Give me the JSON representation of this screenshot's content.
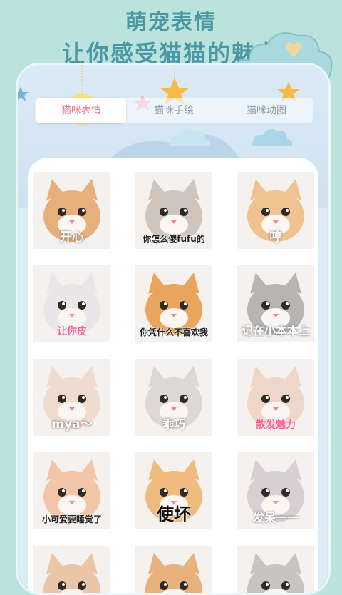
{
  "header": {
    "title_line1": "萌宠表情",
    "title_line2": "让你感受猫猫的魅力"
  },
  "tabs": [
    {
      "label": "猫咪表情",
      "active": true
    },
    {
      "label": "猫咪手绘",
      "active": false
    },
    {
      "label": "猫咪动图",
      "active": false
    }
  ],
  "stickers": [
    {
      "caption": "开心",
      "color": "#e7b07a"
    },
    {
      "caption": "你怎么傻fufu的",
      "color": "#cfc5bd"
    },
    {
      "caption": "哼",
      "color": "#f0c290"
    },
    {
      "caption": "让你皮",
      "color": "#e8e6e8"
    },
    {
      "caption": "你凭什么不喜欢我",
      "color": "#e9a55c"
    },
    {
      "caption": "记在小本本上",
      "color": "#b7b4b4"
    },
    {
      "caption": "mya～",
      "color": "#f0dccf"
    },
    {
      "caption": "乖巧",
      "color": "#ddd8d1"
    },
    {
      "caption": "散发魅力",
      "color": "#eed6c8"
    },
    {
      "caption": "小可爱要睡觉了",
      "color": "#f2c4a8"
    },
    {
      "caption": "使坏",
      "color": "#f0bb7f"
    },
    {
      "caption": "发呆一一",
      "color": "#d8cfd2"
    },
    {
      "caption": "",
      "color": "#eac6a6"
    },
    {
      "caption": "",
      "color": "#e9b27c"
    },
    {
      "caption": "",
      "color": "#c8c4c0"
    }
  ],
  "theme": {
    "background": "#b9e3dc",
    "title_color": "#4b97a3",
    "active_tab_color": "#f0708a"
  }
}
